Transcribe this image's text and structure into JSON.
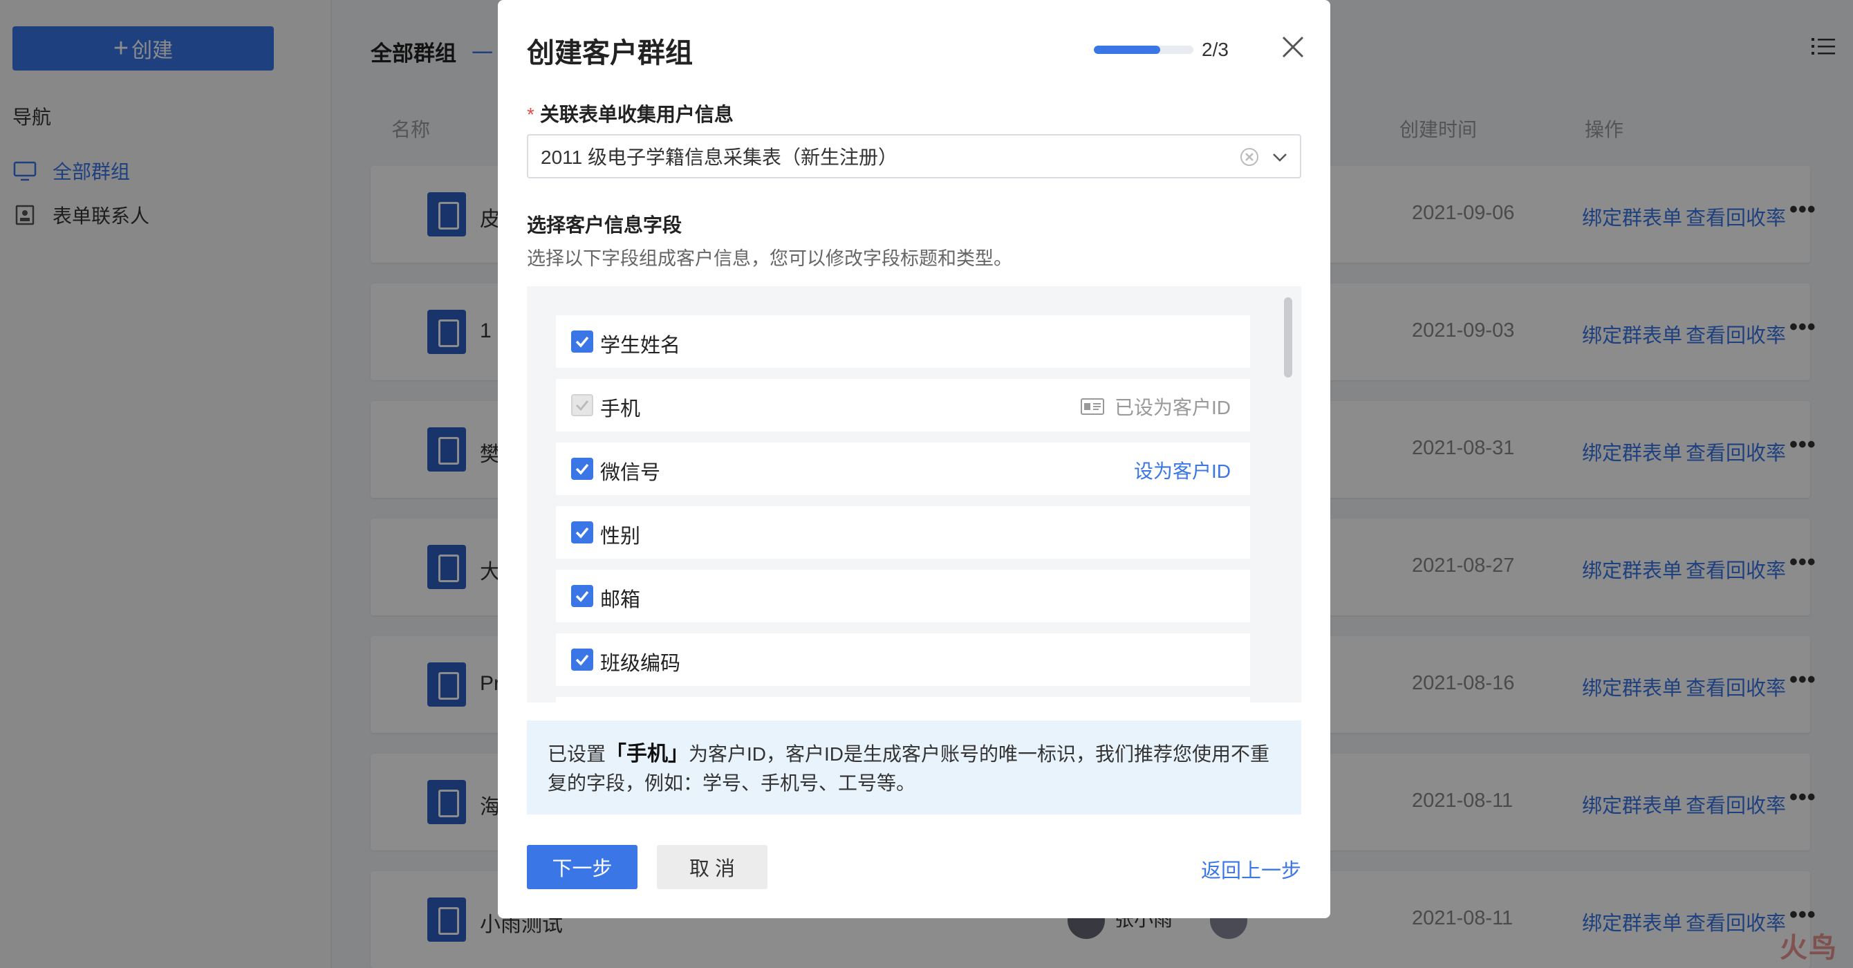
{
  "sidebar": {
    "create_label": "创建",
    "nav_title": "导航",
    "items": [
      {
        "label": "全部群组",
        "active": true
      },
      {
        "label": "表单联系人",
        "active": false
      }
    ]
  },
  "main": {
    "title": "全部群组",
    "subtitle": "一",
    "columns": {
      "name": "名称",
      "created": "创建时间",
      "actions": "操作"
    },
    "rows": [
      {
        "name": "皮",
        "date": "2021-09-06",
        "bind": "绑定群表单",
        "rate": "查看回收率",
        "more": "•••"
      },
      {
        "name": "1",
        "date": "2021-09-03",
        "bind": "绑定群表单",
        "rate": "查看回收率",
        "more": "•••"
      },
      {
        "name": "樊",
        "date": "2021-08-31",
        "bind": "绑定群表单",
        "rate": "查看回收率",
        "more": "•••"
      },
      {
        "name": "大",
        "date": "2021-08-27",
        "bind": "绑定群表单",
        "rate": "查看回收率",
        "more": "•••"
      },
      {
        "name": "Pr",
        "date": "2021-08-16",
        "bind": "绑定群表单",
        "rate": "查看回收率",
        "more": "•••"
      },
      {
        "name": "海",
        "date": "2021-08-11",
        "bind": "绑定群表单",
        "rate": "查看回收率",
        "more": "•••"
      },
      {
        "name": "小雨测试",
        "date": "2021-08-11",
        "bind": "绑定群表单",
        "rate": "查看回收率",
        "more": "•••",
        "person": "张小雨"
      }
    ]
  },
  "modal": {
    "title": "创建客户群组",
    "progress_text": "2/3",
    "progress_fraction": 0.67,
    "form_label": "关联表单收集用户信息",
    "required_mark": "*",
    "select_value": "2011 级电子学籍信息采集表（新生注册）",
    "section_title": "选择客户信息字段",
    "section_desc": "选择以下字段组成客户信息，您可以修改字段标题和类型。",
    "fields": [
      {
        "name": "学生姓名",
        "checked": true,
        "disabled": false,
        "right": ""
      },
      {
        "name": "手机",
        "checked": true,
        "disabled": true,
        "right": "已设为客户ID"
      },
      {
        "name": "微信号",
        "checked": true,
        "disabled": false,
        "right": "设为客户ID"
      },
      {
        "name": "性别",
        "checked": true,
        "disabled": false,
        "right": ""
      },
      {
        "name": "邮箱",
        "checked": true,
        "disabled": false,
        "right": ""
      },
      {
        "name": "班级编码",
        "checked": true,
        "disabled": false,
        "right": ""
      }
    ],
    "info_prefix": "已设置",
    "info_highlight": "「手机」",
    "info_line1_rest": "为客户ID，客户ID是生成客户账号的唯一标识，我们推荐您使用不重",
    "info_line2": "复的字段，例如：学号、手机号、工号等。",
    "btn_next": "下一步",
    "btn_cancel": "取 消",
    "btn_back": "返回上一步"
  },
  "colors": {
    "accent": "#3a76e6",
    "required": "#e94b4b",
    "info_bg": "#e9f3fc"
  },
  "watermark": "火鸟"
}
